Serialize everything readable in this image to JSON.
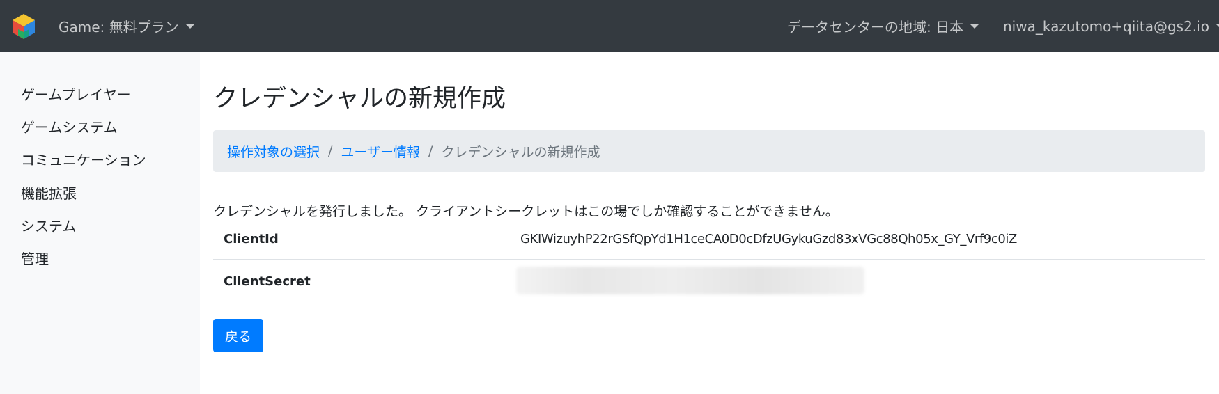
{
  "navbar": {
    "game_label": "Game: 無料プラン",
    "region_label": "データセンターの地域: 日本",
    "user_label": "niwa_kazutomo+qiita@gs2.io"
  },
  "sidebar": {
    "items": [
      {
        "label": "ゲームプレイヤー"
      },
      {
        "label": "ゲームシステム"
      },
      {
        "label": "コミュニケーション"
      },
      {
        "label": "機能拡張"
      },
      {
        "label": "システム"
      },
      {
        "label": "管理"
      }
    ]
  },
  "main": {
    "title": "クレデンシャルの新規作成",
    "breadcrumb": [
      {
        "label": "操作対象の選択"
      },
      {
        "label": "ユーザー情報"
      },
      {
        "label": "クレデンシャルの新規作成"
      }
    ],
    "breadcrumb_separator": "/",
    "message": "クレデンシャルを発行しました。 クライアントシークレットはこの場でしか確認することができません。",
    "credentials": [
      {
        "key": "ClientId",
        "value": "GKIWizuyhP22rGSfQpYd1H1ceCA0D0cDfzUGykuGzd83xVGc88Qh05x_GY_Vrf9c0iZ"
      },
      {
        "key": "ClientSecret"
      }
    ],
    "back_button_label": "戻る"
  },
  "colors": {
    "navbar_bg": "#343a40",
    "sidebar_bg": "#f8f9fa",
    "primary": "#007bff",
    "breadcrumb_bg": "#e9ecef"
  },
  "icons": {
    "logo": "gs2-cube-logo-icon",
    "dropdown": "caret-down-icon"
  }
}
